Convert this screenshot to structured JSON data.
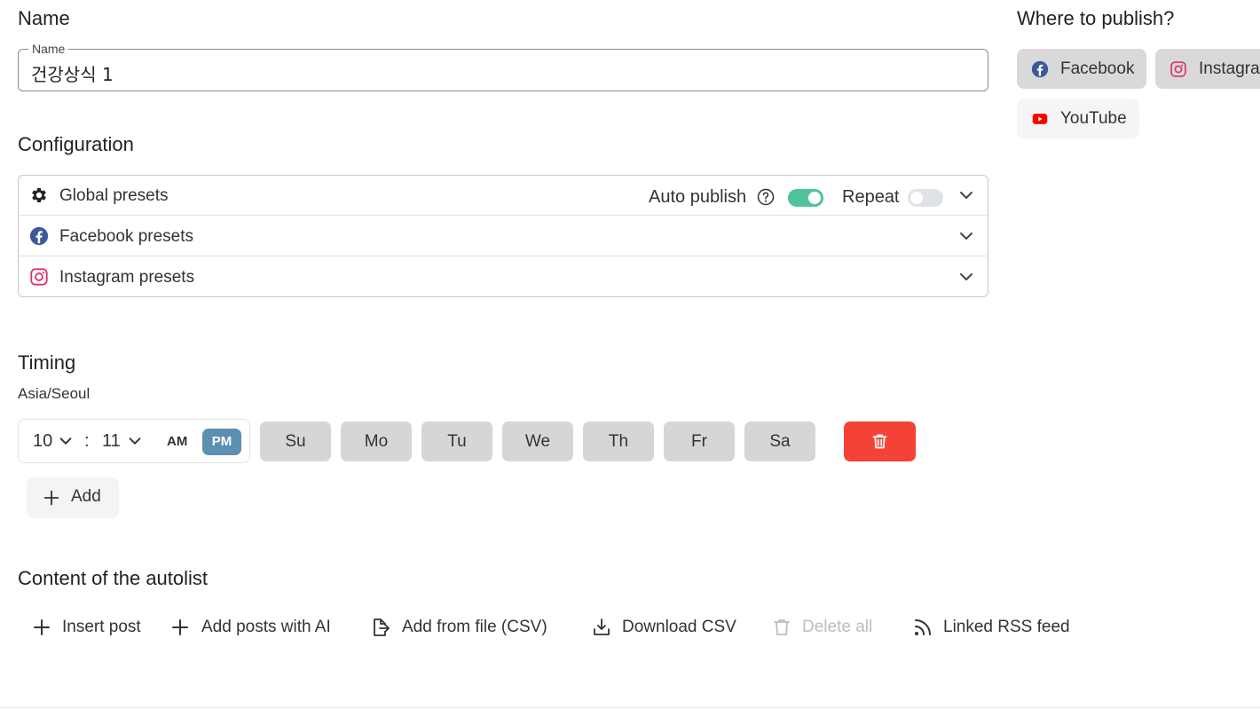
{
  "name_section": {
    "heading": "Name",
    "field_label": "Name",
    "field_value": "건강상식 1"
  },
  "configuration": {
    "heading": "Configuration",
    "rows": [
      {
        "label": "Global presets",
        "icon": "gear-icon"
      },
      {
        "label": "Facebook presets",
        "icon": "facebook-icon"
      },
      {
        "label": "Instagram presets",
        "icon": "instagram-icon"
      }
    ],
    "auto_publish_label": "Auto publish",
    "auto_publish_on": true,
    "repeat_label": "Repeat",
    "repeat_on": false
  },
  "timing": {
    "heading": "Timing",
    "timezone": "Asia/Seoul",
    "hour": "10",
    "minute": "11",
    "sep": ":",
    "am_label": "AM",
    "pm_label": "PM",
    "selected_period": "PM",
    "days": [
      "Su",
      "Mo",
      "Tu",
      "We",
      "Th",
      "Fr",
      "Sa"
    ],
    "add_label": "Add"
  },
  "content": {
    "heading": "Content of the autolist",
    "actions": [
      {
        "label": "Insert post",
        "icon": "plus-icon",
        "enabled": true
      },
      {
        "label": "Add posts with AI",
        "icon": "plus-icon",
        "enabled": true
      },
      {
        "label": "Add from file (CSV)",
        "icon": "file-import-icon",
        "enabled": true
      },
      {
        "label": "Download CSV",
        "icon": "download-icon",
        "enabled": true
      },
      {
        "label": "Delete all",
        "icon": "trash-icon",
        "enabled": false
      },
      {
        "label": "Linked RSS feed",
        "icon": "rss-icon",
        "enabled": true
      }
    ]
  },
  "publish": {
    "heading": "Where to publish?",
    "targets": [
      {
        "label": "Facebook",
        "icon": "facebook-icon",
        "selected": true
      },
      {
        "label": "Instagram",
        "icon": "instagram-icon",
        "selected": true
      },
      {
        "label": "YouTube",
        "icon": "youtube-icon",
        "selected": false
      }
    ]
  },
  "colors": {
    "toggle_on": "#4fc49a",
    "toggle_off": "#dfe3e8",
    "pm_active": "#5d8fb0",
    "danger": "#f44336",
    "facebook": "#3b5998",
    "instagram": "#e1306c",
    "youtube": "#ff0000"
  }
}
